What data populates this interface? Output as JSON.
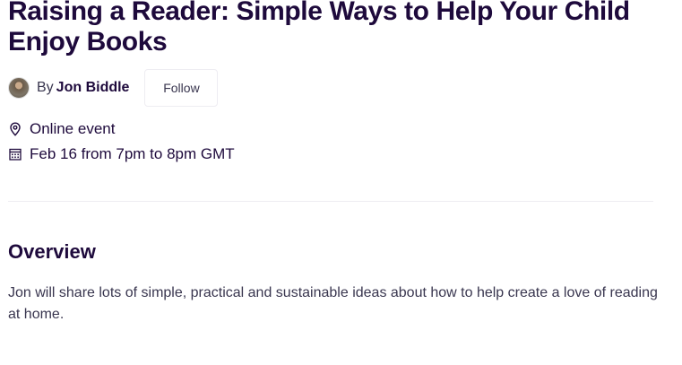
{
  "event": {
    "title": "Raising a Reader: Simple Ways to Help Your Child Enjoy Books"
  },
  "organizer": {
    "by_prefix": "By",
    "name": "Jon Biddle",
    "follow_label": "Follow"
  },
  "details": {
    "location": "Online event",
    "location_icon": "location-pin-icon",
    "datetime": "Feb 16 from 7pm to 8pm GMT",
    "datetime_icon": "calendar-icon"
  },
  "overview": {
    "heading": "Overview",
    "body": "Jon will share lots of simple, practical and sustainable ideas about how to help create a love of reading at home."
  },
  "colors": {
    "heading": "#1e0a3c",
    "body_text": "#39364f",
    "divider": "#eeedf2"
  }
}
